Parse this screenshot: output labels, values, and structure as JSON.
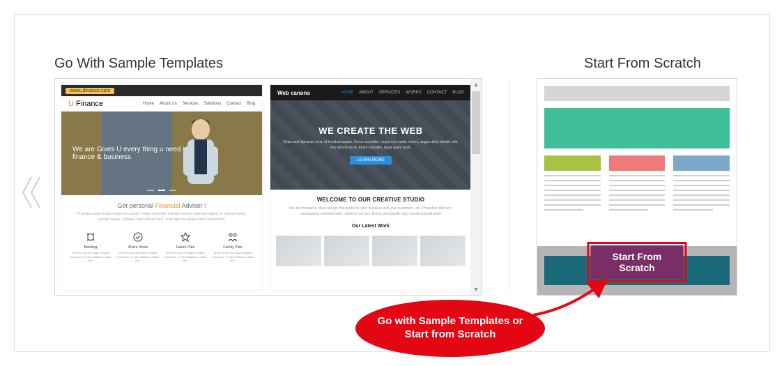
{
  "headings": {
    "templates": "Go With Sample Templates",
    "scratch": "Start From Scratch"
  },
  "template1": {
    "url_label": "www.ufinance.com",
    "logo_u": "U",
    "logo_rest": " Finance",
    "nav": [
      "Home",
      "About Us",
      "Services",
      "Solutions",
      "Contact",
      "Blog"
    ],
    "hero_line1": "We are Gives U every thing u need in",
    "hero_line2": "finance & business",
    "mid_pre": "Get personal ",
    "mid_accent": "Financial",
    "mid_post": " Advisor !",
    "mid_sub": "Phasellus quam turpis ornare accumsan, mattis imperdiet, interdum at que euismod magna, et ultricies lorem, suscipit augue. Quisque vitae ultricies erat. Vitae egestas augue amet consectetur.",
    "features": [
      {
        "label": "Banking",
        "desc": "Amet cursus vel augue fringilla commodo. In hac habitasse platea dict."
      },
      {
        "label": "Share Stock",
        "desc": "Amet cursus vel augue fringilla commodo. In hac habitasse platea dict."
      },
      {
        "label": "Future Plan",
        "desc": "Amet cursus vel augue fringilla commodo. In hac habitasse platea dict."
      },
      {
        "label": "Family Plan",
        "desc": "Amet cursus vel augue fringilla commodo. In hac habitasse platea dict."
      }
    ]
  },
  "template2": {
    "logo": "Web canons",
    "nav": [
      "HOME",
      "ABOUT",
      "SERVICES",
      "WORKS",
      "CONTACT",
      "BLOG"
    ],
    "hero_title": "WE CREATE THE WEB",
    "hero_sub": "Etiam sed dignissim urna, id tincidunt sapien. Donec convallis, neque nec mattis viverra, augue dolor blandit velit, non lobortis ex et. Etiam convallis, ligula quam amet.",
    "hero_btn": "LEARN MORE",
    "mid_title": "WELCOME TO OUR CREATIVE STUDIO",
    "mid_sub": "We are focused in clean design that works for your business and your customers, etc. Phasellus odio orci, consequat in hendrerit vitae, eleifend non orci. Donec sed blandit nunc cursus suscipit amet.",
    "latest_work": "Our Latest Work"
  },
  "scratch": {
    "button": "Start From Scratch"
  },
  "callout": {
    "text": "Go with Sample Templates or Start from Scratch"
  }
}
